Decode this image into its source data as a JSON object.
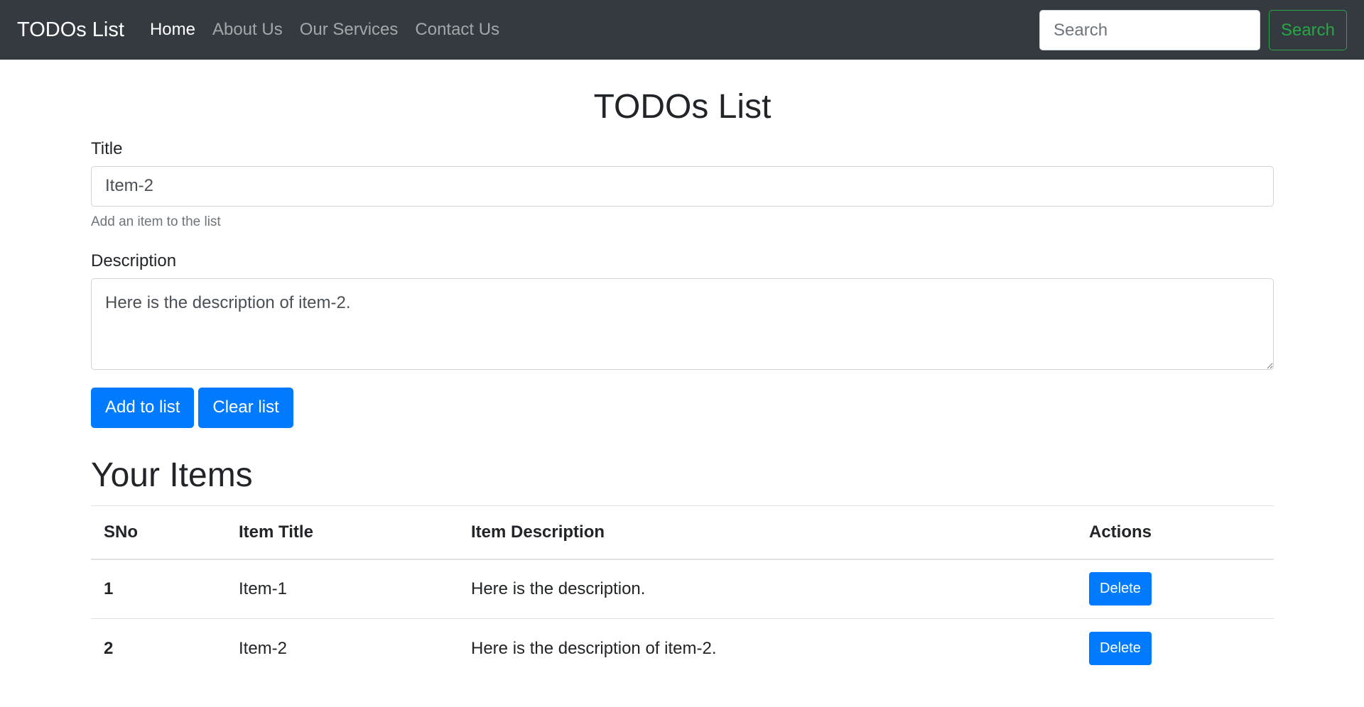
{
  "navbar": {
    "brand": "TODOs List",
    "links": [
      "Home",
      "About Us",
      "Our Services",
      "Contact Us"
    ],
    "search_placeholder": "Search",
    "search_button": "Search"
  },
  "main": {
    "page_title": "TODOs List",
    "title_label": "Title",
    "title_value": "Item-2",
    "title_help": "Add an item to the list",
    "description_label": "Description",
    "description_value": "Here is the description of item-2.",
    "add_button": "Add to list",
    "clear_button": "Clear list"
  },
  "items": {
    "heading": "Your Items",
    "columns": [
      "SNo",
      "Item Title",
      "Item Description",
      "Actions"
    ],
    "rows": [
      {
        "sno": "1",
        "title": "Item-1",
        "description": "Here is the description.",
        "action": "Delete"
      },
      {
        "sno": "2",
        "title": "Item-2",
        "description": "Here is the description of item-2.",
        "action": "Delete"
      }
    ]
  },
  "colors": {
    "navbar_bg": "#343a40",
    "primary": "#007bff",
    "success": "#28a745"
  }
}
